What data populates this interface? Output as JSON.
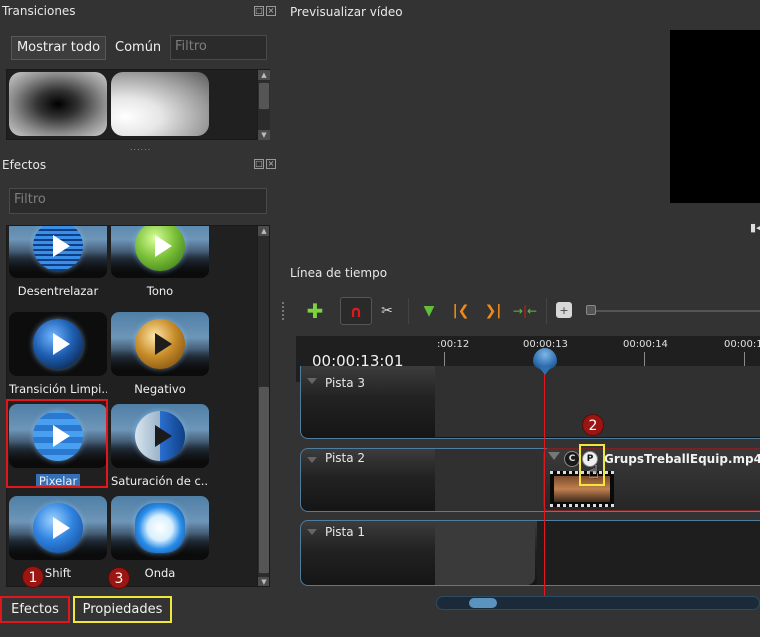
{
  "transitions_panel": {
    "title": "Transiciones",
    "show_all_label": "Mostrar todo",
    "common_label": "Común",
    "filter_placeholder": "Filtro",
    "splitter_grip": "......"
  },
  "effects_panel": {
    "title": "Efectos",
    "filter_placeholder": "Filtro",
    "items": [
      {
        "label": "Desentrelazar",
        "orb": "lines"
      },
      {
        "label": "Tono",
        "orb": "green"
      },
      {
        "label": "Transición Limpi...",
        "orb": "dark"
      },
      {
        "label": "Negativo",
        "orb": "gold"
      },
      {
        "label": "Pixelar",
        "orb": "pixel",
        "selected": true
      },
      {
        "label": "Saturación de c...",
        "orb": "split"
      },
      {
        "label": "Shift",
        "orb": "shift"
      },
      {
        "label": "Onda",
        "orb": "cloud"
      }
    ]
  },
  "bottom_tabs": {
    "effects": "Efectos",
    "properties": "Propiedades"
  },
  "annotations": [
    "1",
    "2",
    "3"
  ],
  "preview": {
    "title": "Previsualizar vídeo"
  },
  "timeline": {
    "title": "Línea de tiempo",
    "current_time": "00:00:13:01",
    "ruler_labels": [
      ":00:12",
      "00:00:13",
      "00:00:14",
      "00:00:1"
    ],
    "tracks": [
      {
        "label": "Pista 3"
      },
      {
        "label": "Pista 2"
      },
      {
        "label": "Pista 1"
      }
    ],
    "clip": {
      "name": "GrupsTreballEquip.mp4",
      "c_icon": "C",
      "p_icon": "P"
    },
    "toolbar_icons": [
      "add-track-icon",
      "snap-magnet-icon",
      "razor-icon",
      "add-marker-icon",
      "previous-marker-icon",
      "next-marker-icon",
      "center-playhead-icon",
      "zoom-icon"
    ]
  },
  "colors": {
    "annotation_red": "#e0181e",
    "annotation_yellow": "#f0e63c",
    "selection_blue": "#3370b7",
    "badge_red": "#9b1512"
  }
}
